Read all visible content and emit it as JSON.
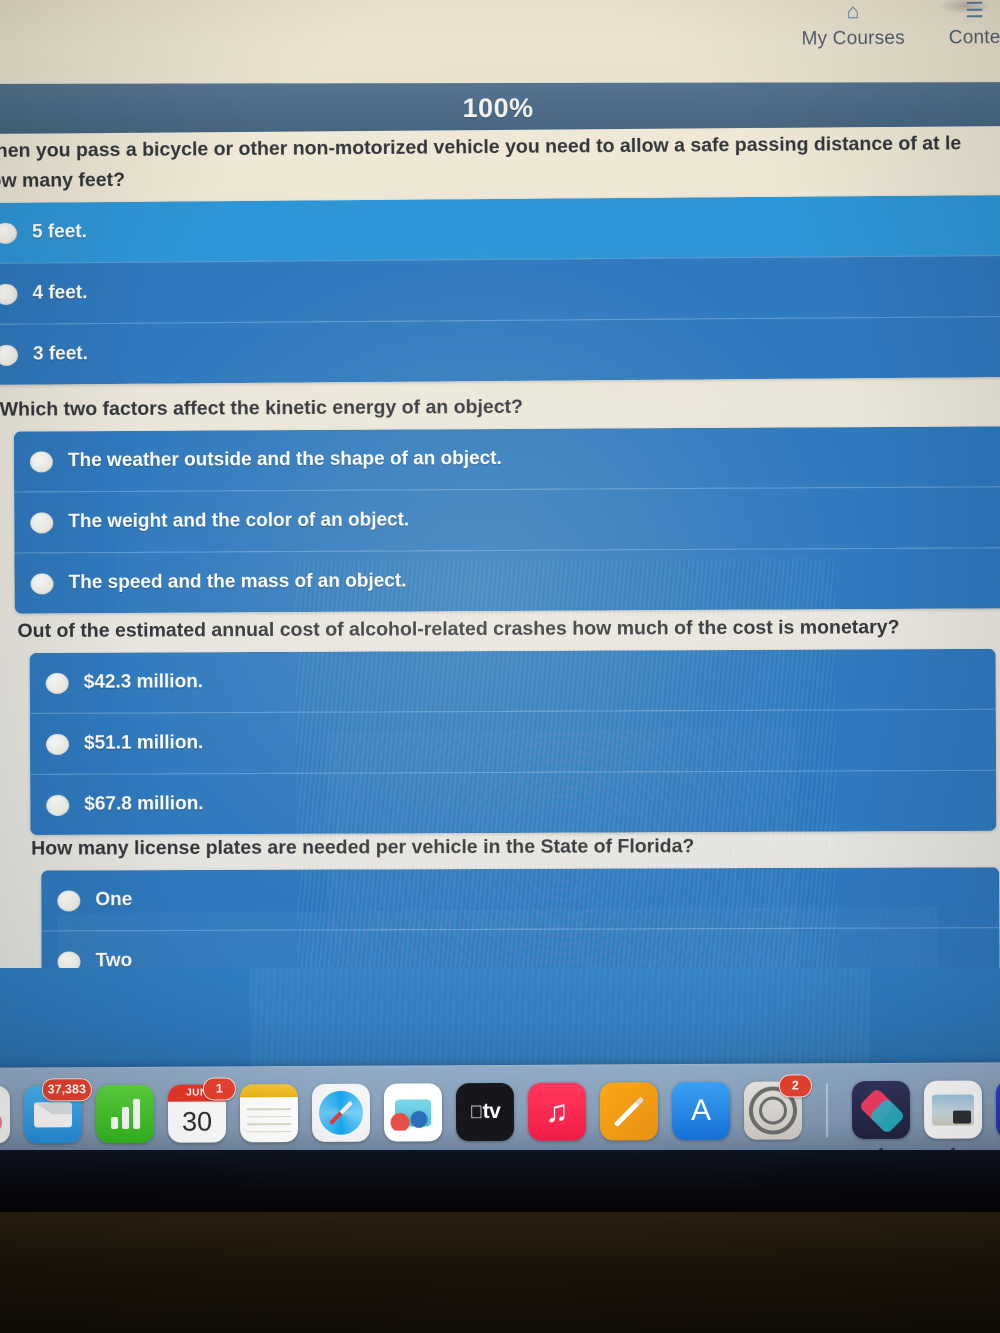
{
  "nav": {
    "items": [
      {
        "label": "My Courses",
        "icon": "home-icon",
        "glyph": "⌂"
      },
      {
        "label": "Conte",
        "icon": "list-icon",
        "glyph": "☰"
      }
    ]
  },
  "progress": {
    "label": "100%",
    "percent": 100,
    "bar_color": "#4c6c89"
  },
  "quiz": {
    "questions": [
      {
        "id": "q1",
        "text_line1": "When you pass a bicycle or other non-motorized vehicle you need to allow a safe passing distance of at le",
        "text_line2": "how many feet?",
        "options": [
          {
            "label": "5 feet.",
            "highlighted": true
          },
          {
            "label": "4 feet.",
            "highlighted": false
          },
          {
            "label": "3 feet.",
            "highlighted": false
          }
        ]
      },
      {
        "id": "q2",
        "text_line1": "Which two factors affect the kinetic energy of an object?",
        "text_line2": "",
        "options": [
          {
            "label": "The weather outside and the shape of an object.",
            "highlighted": false
          },
          {
            "label": "The weight and the color of an object.",
            "highlighted": false
          },
          {
            "label": "The speed and the mass of an object.",
            "highlighted": false
          }
        ]
      },
      {
        "id": "q3",
        "text_line1": "Out of the estimated annual cost of alcohol-related crashes how much of the cost is monetary?",
        "text_line2": "",
        "options": [
          {
            "label": "$42.3 million.",
            "highlighted": false
          },
          {
            "label": "$51.1 million.",
            "highlighted": false
          },
          {
            "label": "$67.8 million.",
            "highlighted": false
          }
        ]
      },
      {
        "id": "q4",
        "text_line1": "How many license plates are needed per vehicle in the State of Florida?",
        "text_line2": "",
        "options": [
          {
            "label": "One",
            "highlighted": false
          },
          {
            "label": "Two",
            "highlighted": false
          }
        ]
      }
    ]
  },
  "dock": {
    "items": [
      {
        "name": "photos",
        "badge": ""
      },
      {
        "name": "mail",
        "badge": "37,383"
      },
      {
        "name": "numbers",
        "badge": ""
      },
      {
        "name": "calendar",
        "badge": "1",
        "month": "JUN",
        "day": "30"
      },
      {
        "name": "notes",
        "badge": ""
      },
      {
        "name": "safari",
        "badge": ""
      },
      {
        "name": "preview-photo",
        "badge": ""
      },
      {
        "name": "apple-tv",
        "badge": "",
        "label": "tv"
      },
      {
        "name": "music",
        "badge": "",
        "glyph": "♫"
      },
      {
        "name": "pages",
        "badge": ""
      },
      {
        "name": "app-store",
        "badge": "",
        "glyph": "A"
      },
      {
        "name": "system-preferences",
        "badge": "2"
      },
      {
        "name": "shortcuts",
        "badge": ""
      },
      {
        "name": "preview",
        "badge": ""
      },
      {
        "name": "cursor-app",
        "badge": ""
      }
    ]
  },
  "colors": {
    "page_bg": "#ece3cf",
    "option_blue": "#2f79bd",
    "option_blue_highlight": "#2e96d6",
    "progress_blue": "#4c6c89",
    "wallpaper_blue": "#2d79bb"
  }
}
